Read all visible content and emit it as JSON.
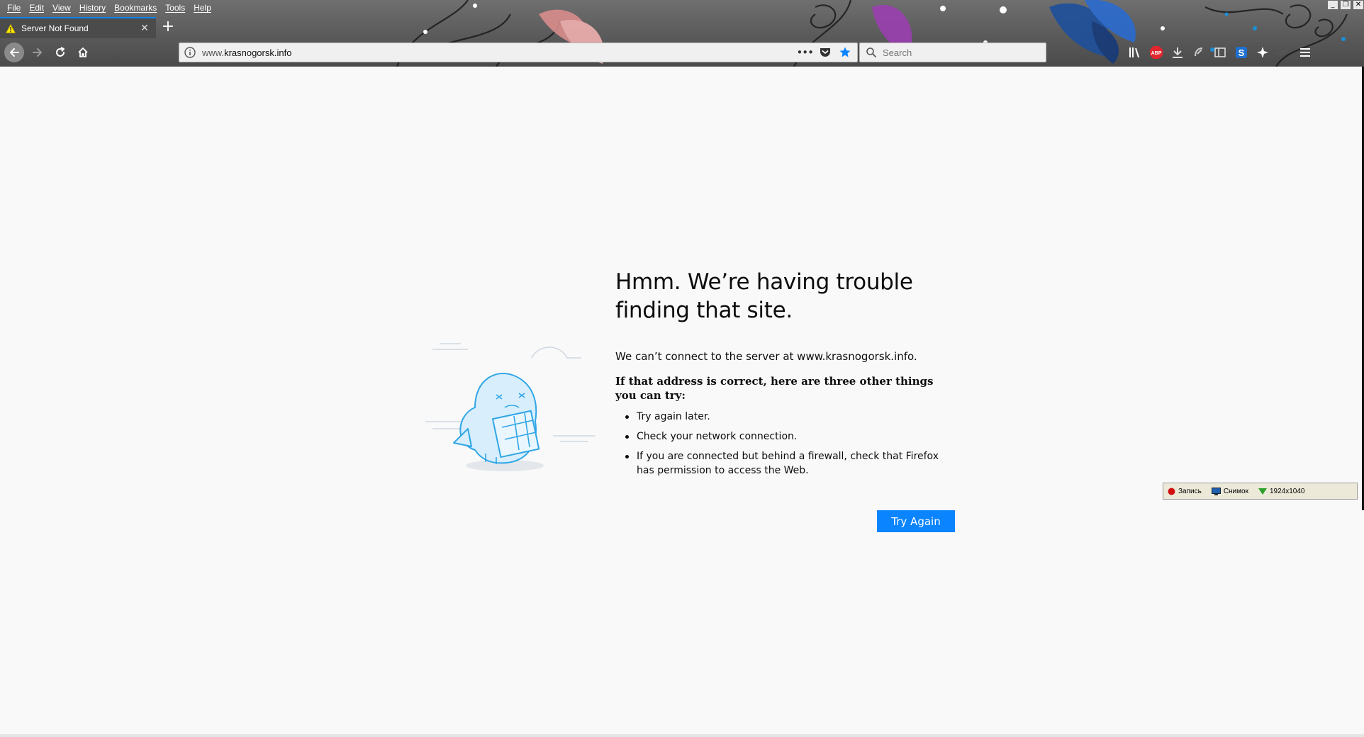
{
  "menubar": {
    "items": [
      "File",
      "Edit",
      "View",
      "History",
      "Bookmarks",
      "Tools",
      "Help"
    ]
  },
  "tab": {
    "title": "Server Not Found",
    "close": "✕",
    "new_tab": "+"
  },
  "urlbar": {
    "url_prefix": "www.",
    "url_domain": "krasnogorsk.info",
    "page_actions": "•••"
  },
  "search": {
    "placeholder": "Search"
  },
  "window_controls": {
    "minimize": "_",
    "restore": "❐",
    "close": "✕"
  },
  "error": {
    "title": "Hmm. We’re having trouble finding that site.",
    "description": "We can’t connect to the server at www.krasnogorsk.info.",
    "strong": "If that address is correct, here are three other things you can try:",
    "suggestions": [
      "Try again later.",
      "Check your network connection.",
      "If you are connected but behind a firewall, check that Firefox has permission to access the Web."
    ],
    "button": "Try Again"
  },
  "recorder": {
    "record": "Запись",
    "snapshot": "Снимок",
    "resolution": "1924x1040"
  },
  "colors": {
    "accent": "#0a84ff",
    "tab_border": "#0a84ff",
    "background": "#f9f9fa"
  },
  "icons": [
    "warning-icon",
    "back-icon",
    "forward-icon",
    "reload-icon",
    "home-icon",
    "info-icon",
    "pocket-icon",
    "star-icon",
    "search-icon",
    "library-icon",
    "adblock-icon",
    "download-icon",
    "addon-icon",
    "sidebar-icon",
    "skype-icon",
    "extension-icon",
    "bird-icon",
    "menu-icon"
  ]
}
